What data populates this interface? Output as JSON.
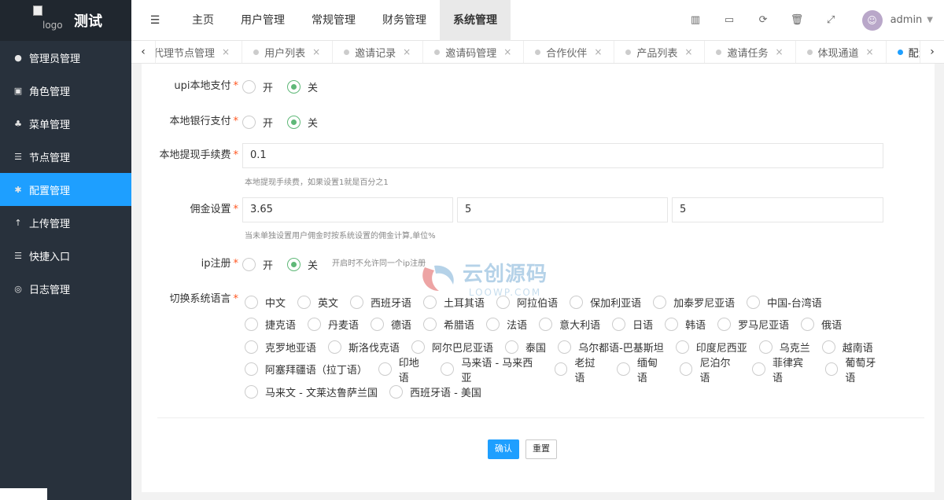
{
  "app": {
    "title": "测试",
    "logo_alt": "logo"
  },
  "sidebar": {
    "items": [
      {
        "label": "管理员管理",
        "icon": "user-icon"
      },
      {
        "label": "角色管理",
        "icon": "role-icon"
      },
      {
        "label": "菜单管理",
        "icon": "tree-icon"
      },
      {
        "label": "节点管理",
        "icon": "list-icon"
      },
      {
        "label": "配置管理",
        "icon": "asterisk-icon",
        "active": true
      },
      {
        "label": "上传管理",
        "icon": "upload-arrow-icon"
      },
      {
        "label": "快捷入口",
        "icon": "list-icon"
      },
      {
        "label": "日志管理",
        "icon": "log-icon"
      }
    ]
  },
  "topnav": {
    "items": [
      "主页",
      "用户管理",
      "常规管理",
      "财务管理",
      "系统管理"
    ],
    "active": "系统管理",
    "user": "admin"
  },
  "tabs": [
    {
      "label": "代理节点管理"
    },
    {
      "label": "用户列表"
    },
    {
      "label": "邀请记录"
    },
    {
      "label": "邀请码管理"
    },
    {
      "label": "合作伙伴"
    },
    {
      "label": "产品列表"
    },
    {
      "label": "邀请任务"
    },
    {
      "label": "体现通道"
    },
    {
      "label": "配置管理",
      "active": true
    }
  ],
  "form": {
    "upi": {
      "label": "upi本地支付",
      "on": "开",
      "off": "关",
      "selected": "关"
    },
    "bank": {
      "label": "本地银行支付",
      "on": "开",
      "off": "关",
      "selected": "关"
    },
    "fee": {
      "label": "本地提现手续费",
      "value": "0.1",
      "hint": "本地提现手续费，如果设置1就是百分之1"
    },
    "commission": {
      "label": "佣金设置",
      "values": [
        "3.65",
        "5",
        "5"
      ],
      "hint": "当未单独设置用户佣金时按系统设置的佣金计算,单位%"
    },
    "ip": {
      "label": "ip注册",
      "on": "开",
      "off": "关",
      "selected": "关",
      "hint": "开启时不允许同一个ip注册"
    },
    "language": {
      "label": "切换系统语言",
      "rows": [
        [
          "中文",
          "英文",
          "西班牙语",
          "土耳其语",
          "阿拉伯语",
          "保加利亚语",
          "加泰罗尼亚语",
          "中国-台湾语"
        ],
        [
          "捷克语",
          "丹麦语",
          "德语",
          "希腊语",
          "法语",
          "意大利语",
          "日语",
          "韩语",
          "罗马尼亚语",
          "俄语"
        ],
        [
          "克罗地亚语",
          "斯洛伐克语",
          "阿尔巴尼亚语",
          "泰国",
          "乌尔都语-巴基斯坦",
          "印度尼西亚",
          "乌克兰",
          "越南语"
        ],
        [
          "阿塞拜疆语（拉丁语）",
          "印地语",
          "马来语 - 马来西亚",
          "老挝语",
          "缅甸语",
          "尼泊尔语",
          "菲律宾语",
          "葡萄牙语"
        ],
        [
          "马来文 - 文莱达鲁萨兰国",
          "西班牙语 - 美国"
        ]
      ]
    },
    "submit": "确认",
    "reset": "重置"
  },
  "watermark": {
    "cn": "云创源码",
    "en": "LOOWP.COM"
  },
  "colors": {
    "primary": "#1e9fff",
    "sidebar": "#28313c",
    "radio_on": "#5fb878",
    "required": "#ff5722"
  }
}
